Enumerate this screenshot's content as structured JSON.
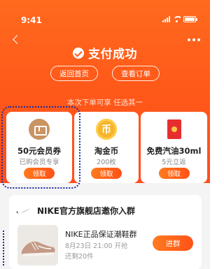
{
  "status_bar": {
    "time": "9:41"
  },
  "header": {
    "title": "支付成功",
    "buttons": {
      "home": "返回首页",
      "order": "查看订单"
    }
  },
  "rewards": {
    "hint": "本次下单可享 任选其一",
    "items": [
      {
        "title": "50元会员券",
        "subtitle": "已购会员专享",
        "button": "领取",
        "icon": "coupon-icon"
      },
      {
        "title": "淘金币",
        "subtitle": "200枚",
        "button": "领取",
        "icon": "coin-icon",
        "icon_glyph": "币"
      },
      {
        "title": "免费汽油30ml",
        "subtitle": "5元立返",
        "button": "领取",
        "icon": "red-envelope-icon"
      }
    ]
  },
  "shop": {
    "title": "NIKE官方旗舰店邀你入群",
    "group": {
      "name": "NIKE正品保证潮鞋群",
      "time": "8月23日 21:00 开抢",
      "remaining": "还剩20件",
      "button": "进群"
    }
  },
  "colors": {
    "brand": "#ff5a1a",
    "highlight_outline": "#1a2aa0"
  }
}
